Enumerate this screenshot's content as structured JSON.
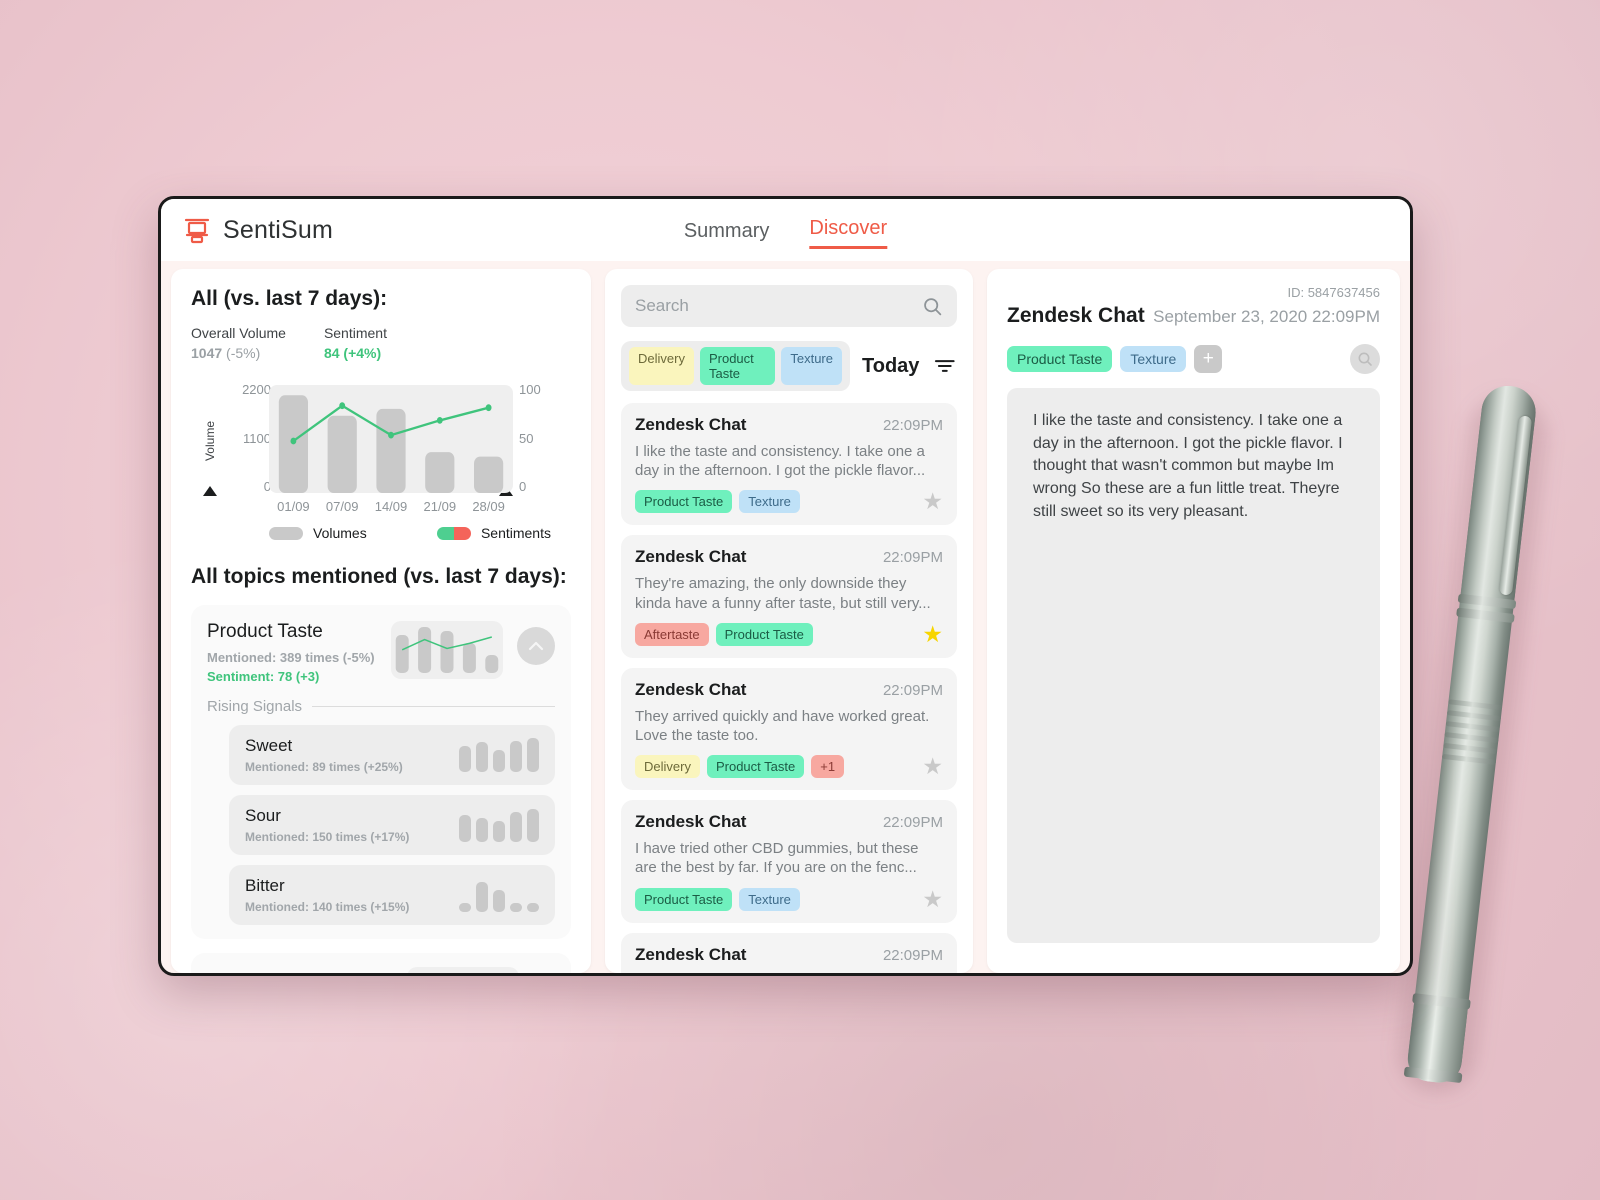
{
  "app": {
    "brand": "SentiSum",
    "logo_icon": "funnel-cart-icon",
    "tabs": [
      {
        "label": "Summary",
        "active": false
      },
      {
        "label": "Discover",
        "active": true
      }
    ],
    "accent": "#ef5b47",
    "positive_color": "#3fc47c"
  },
  "left": {
    "heading": "All (vs. last 7 days):",
    "kpis": [
      {
        "label": "Overall Volume",
        "value": "1047",
        "delta": "(-5%)",
        "positive": false
      },
      {
        "label": "Sentiment",
        "value": "84",
        "delta": "(+4%)",
        "positive": true
      }
    ],
    "legend": [
      {
        "label": "Volumes",
        "swatch": "volume-bar"
      },
      {
        "label": "Sentiments",
        "swatch": "sentiment-split"
      }
    ],
    "topics_heading": "All topics mentioned (vs. last 7 days):",
    "topic": {
      "name": "Product Taste",
      "mentioned": "Mentioned: 389 times (-5%)",
      "sentiment": "Sentiment: 78 (+3)",
      "collapse_icon": "chevron-up-icon",
      "rising_label": "Rising Signals",
      "signals": [
        {
          "name": "Sweet",
          "meta": "Mentioned: 89 times (+25%)",
          "bars": [
            26,
            30,
            22,
            31,
            34
          ]
        },
        {
          "name": "Sour",
          "meta": "Mentioned: 150 times (+17%)",
          "bars": [
            27,
            24,
            21,
            30,
            33
          ]
        },
        {
          "name": "Bitter",
          "meta": "Mentioned: 140 times (+15%)",
          "bars": [
            9,
            30,
            22,
            9,
            9
          ]
        }
      ]
    }
  },
  "chart_data": {
    "type": "bar",
    "title": "All (vs. last 7 days)",
    "categories": [
      "01/09",
      "07/09",
      "14/09",
      "21/09",
      "28/09"
    ],
    "series": [
      {
        "name": "Volumes",
        "type": "bar",
        "axis": "left",
        "values": [
          2150,
          1700,
          1850,
          900,
          800
        ]
      },
      {
        "name": "Sentiments",
        "type": "line",
        "axis": "right",
        "values": [
          51,
          87,
          57,
          72,
          85
        ]
      }
    ],
    "xlabel": "",
    "ylabel": "Volume",
    "y2label": "Sentiment",
    "ylim": [
      0,
      2200
    ],
    "y2lim": [
      0,
      100
    ],
    "yticks": [
      "2200",
      "1100",
      "0"
    ],
    "y2ticks": [
      "100",
      "50",
      "0"
    ],
    "grid": false,
    "legend_position": "bottom",
    "bar_color": "#c9c9c9",
    "line_color": "#3fc47c"
  },
  "sparklines": {
    "topic": {
      "bars": [
        38,
        46,
        42,
        30,
        18
      ],
      "line": [
        30,
        46,
        32,
        40,
        50
      ]
    }
  },
  "middle": {
    "search": {
      "placeholder": "Search",
      "value": "",
      "icon": "search-icon"
    },
    "filter_chips": [
      {
        "label": "Delivery",
        "color": "yellow"
      },
      {
        "label": "Product Taste",
        "color": "green"
      },
      {
        "label": "Texture",
        "color": "blue"
      }
    ],
    "today_label": "Today",
    "filter_icon": "filter-icon",
    "feed": [
      {
        "source": "Zendesk Chat",
        "time": "22:09PM",
        "text": "I like the taste and consistency. I take one a day in the afternoon. I got the pickle flavor...",
        "tags": [
          {
            "label": "Product Taste",
            "color": "green"
          },
          {
            "label": "Texture",
            "color": "blue"
          }
        ],
        "starred": false
      },
      {
        "source": "Zendesk Chat",
        "time": "22:09PM",
        "text": "They're amazing, the only downside they kinda have a funny after taste, but still very...",
        "tags": [
          {
            "label": "Aftertaste",
            "color": "red"
          },
          {
            "label": "Product Taste",
            "color": "green"
          }
        ],
        "starred": true
      },
      {
        "source": "Zendesk Chat",
        "time": "22:09PM",
        "text": "They arrived quickly and have worked great. Love the taste too.",
        "tags": [
          {
            "label": "Delivery",
            "color": "yellow"
          },
          {
            "label": "Product Taste",
            "color": "green"
          },
          {
            "label": "+1",
            "color": "red"
          }
        ],
        "starred": false
      },
      {
        "source": "Zendesk Chat",
        "time": "22:09PM",
        "text": "I have tried other CBD gummies, but these are the best by far. If you are on the fenc...",
        "tags": [
          {
            "label": "Product Taste",
            "color": "green"
          },
          {
            "label": "Texture",
            "color": "blue"
          }
        ],
        "starred": false
      },
      {
        "source": "Zendesk Chat",
        "time": "22:09PM",
        "text": "",
        "tags": [],
        "starred": false
      }
    ]
  },
  "right": {
    "id": "ID: 5847637456",
    "title": "Zendesk Chat",
    "date": "September 23, 2020 22:09PM",
    "tags": [
      {
        "label": "Product Taste",
        "color": "green"
      },
      {
        "label": "Texture",
        "color": "blue"
      }
    ],
    "add_tag_label": "+",
    "zoom_icon": "magnifier-icon",
    "body": "I like the taste and consistency. I take one a day in the afternoon. I got the pickle flavor. I thought that wasn't common but maybe Im wrong So these are a fun little treat. Theyre still sweet so its very pleasant."
  }
}
